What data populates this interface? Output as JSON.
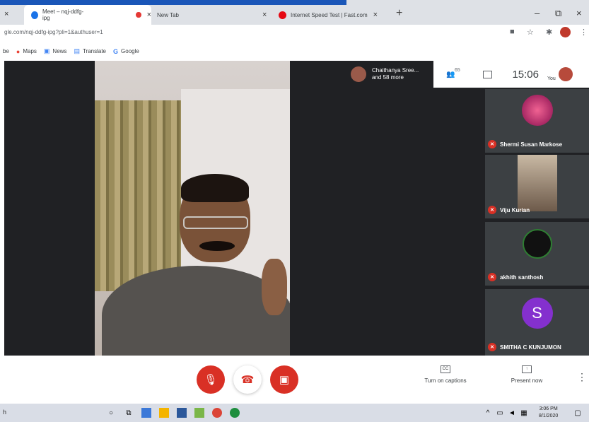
{
  "browser": {
    "tabs": [
      {
        "label": "Meet – nqj-ddfg-ipg",
        "favicon_color": "#1a73e8"
      },
      {
        "label": "New Tab",
        "favicon_color": "#888888"
      },
      {
        "label": "Internet Speed Test | Fast.com",
        "favicon_color": "#e50914"
      }
    ],
    "new_tab_symbol": "+",
    "close_symbol": "×",
    "window_controls": [
      "–",
      "⧉",
      "×"
    ],
    "url": "gle.com/nqj-ddfg-ipg?pli=1&authuser=1",
    "bookmarks": [
      {
        "label": "be",
        "icon": "youtube-icon"
      },
      {
        "label": "Maps",
        "icon": "maps-icon"
      },
      {
        "label": "News",
        "icon": "news-icon"
      },
      {
        "label": "Translate",
        "icon": "translate-icon"
      },
      {
        "label": "Google",
        "icon": "google-icon"
      }
    ]
  },
  "meet": {
    "participants_summary": {
      "line1": "Chaithanya Sree...",
      "line2": "and 58 more"
    },
    "people_count": "65",
    "time": "15:06",
    "you_label": "You",
    "tiles": [
      {
        "name": "Shermi Susan Markose",
        "avatar": "pink-flower",
        "color": "#c2185b"
      },
      {
        "name": "Viju Kurian",
        "avatar": "video",
        "color": "#6d5a4a"
      },
      {
        "name": "akhith santhosh",
        "avatar": "skull",
        "color": "#1b1b1b"
      },
      {
        "name": "SMITHA C KUNJUMON",
        "avatar": "S",
        "color": "#8430ce"
      }
    ],
    "controls": {
      "captions_label": "Turn on captions",
      "captions_icon_text": "CC",
      "present_label": "Present now",
      "mic_color": "#d93025",
      "hangup_color": "#d93025",
      "cam_color": "#d93025"
    }
  },
  "taskbar": {
    "search_text": "h",
    "time": "3:06 PM",
    "date": "8/1/2020"
  }
}
